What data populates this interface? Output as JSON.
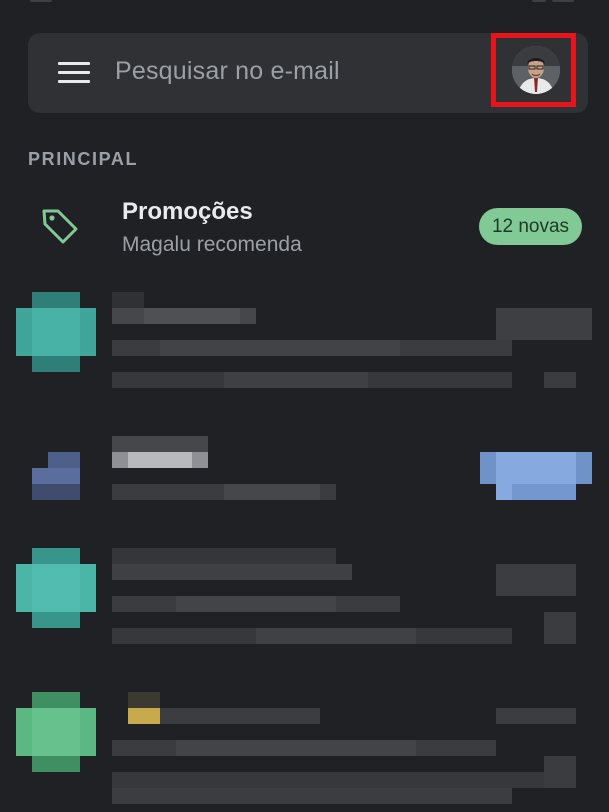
{
  "search": {
    "placeholder": "Pesquisar no e-mail",
    "menu_icon": "hamburger-menu-icon",
    "avatar_icon": "account-avatar"
  },
  "section": {
    "label": "PRINCIPAL"
  },
  "promotions": {
    "icon": "tag-icon",
    "title": "Promoções",
    "subtitle": "Magalu recomenda",
    "badge": "12 novas",
    "accent": "#81c995"
  },
  "colors": {
    "background": "#202124",
    "search_bar": "#303134",
    "highlight": "#e8141b"
  },
  "emails": [
    {
      "avatar_color": "#3fa59b"
    },
    {
      "avatar_color": "#5a6e9e"
    },
    {
      "avatar_color": "#4bb5a8"
    },
    {
      "avatar_color": "#5cb883"
    }
  ]
}
